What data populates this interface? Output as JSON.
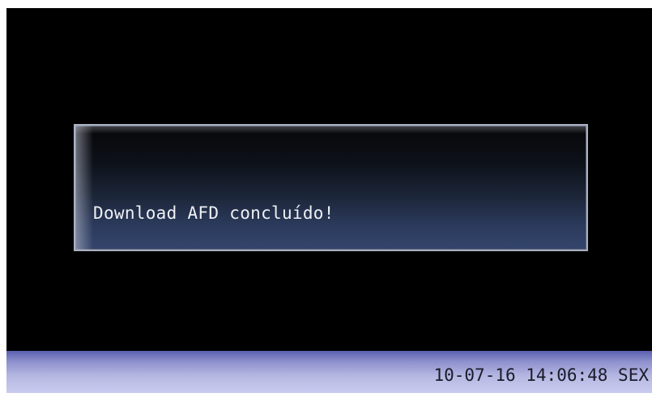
{
  "dialog": {
    "message": "Download AFD concluído!"
  },
  "status_bar": {
    "datetime": "10-07-16 14:06:48 SEX"
  },
  "colors": {
    "screen_background": "#000000",
    "dialog_gradient_bottom": "#34456c",
    "status_bar": "#b6b8e2"
  }
}
